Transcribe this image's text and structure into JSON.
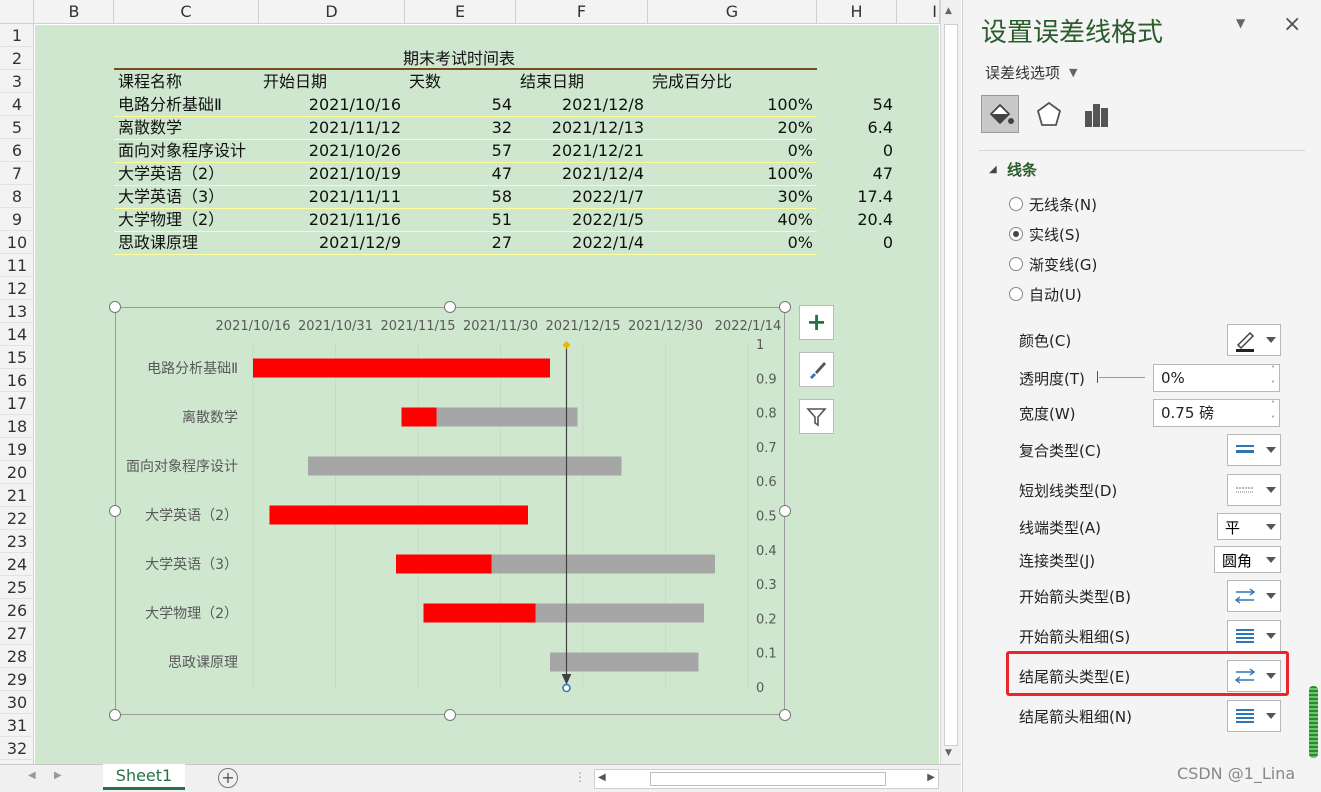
{
  "columns": [
    "B",
    "C",
    "D",
    "E",
    "F",
    "G",
    "H",
    "I"
  ],
  "rows": [
    "1",
    "2",
    "3",
    "4",
    "5",
    "6",
    "7",
    "8",
    "9",
    "10",
    "11",
    "12",
    "13",
    "14",
    "15",
    "16",
    "17",
    "18",
    "19",
    "20",
    "21",
    "22",
    "23",
    "24",
    "25",
    "26",
    "27",
    "28",
    "29",
    "30",
    "31",
    "32"
  ],
  "table": {
    "title": "期末考试时间表",
    "headers": [
      "课程名称",
      "开始日期",
      "天数",
      "结束日期",
      "完成百分比"
    ],
    "rows": [
      {
        "course": "电路分析基础Ⅱ",
        "start": "2021/10/16",
        "days": "54",
        "end": "2021/12/8",
        "pct": "100%",
        "h": "54"
      },
      {
        "course": "离散数学",
        "start": "2021/11/12",
        "days": "32",
        "end": "2021/12/13",
        "pct": "20%",
        "h": "6.4"
      },
      {
        "course": "面向对象程序设计",
        "start": "2021/10/26",
        "days": "57",
        "end": "2021/12/21",
        "pct": "0%",
        "h": "0"
      },
      {
        "course": "大学英语（2）",
        "start": "2021/10/19",
        "days": "47",
        "end": "2021/12/4",
        "pct": "100%",
        "h": "47"
      },
      {
        "course": "大学英语（3）",
        "start": "2021/11/11",
        "days": "58",
        "end": "2022/1/7",
        "pct": "30%",
        "h": "17.4"
      },
      {
        "course": "大学物理（2）",
        "start": "2021/11/16",
        "days": "51",
        "end": "2022/1/5",
        "pct": "40%",
        "h": "20.4"
      },
      {
        "course": "思政课原理",
        "start": "2021/12/9",
        "days": "27",
        "end": "2022/1/4",
        "pct": "0%",
        "h": "0"
      }
    ]
  },
  "chart_data": {
    "type": "bar",
    "orientation": "horizontal-stacked-gantt",
    "categories": [
      "电路分析基础Ⅱ",
      "离散数学",
      "面向对象程序设计",
      "大学英语（2）",
      "大学英语（3）",
      "大学物理（2）",
      "思政课原理"
    ],
    "x_tick_labels": [
      "2021/10/16",
      "2021/10/31",
      "2021/11/15",
      "2021/11/30",
      "2021/12/15",
      "2021/12/30",
      "2022/1/14"
    ],
    "x_range": [
      "2021/10/16",
      "2022/1/14"
    ],
    "start": [
      "2021/10/16",
      "2021/11/12",
      "2021/10/26",
      "2021/10/19",
      "2021/11/11",
      "2021/11/16",
      "2021/12/9"
    ],
    "series": [
      {
        "values": [
          54,
          6.4,
          0,
          47,
          17.4,
          20.4,
          0
        ],
        "color": "#ff0000"
      },
      {
        "values": [
          0,
          25.6,
          57,
          0,
          40.6,
          30.6,
          27
        ],
        "color": "#a6a6a6"
      }
    ],
    "secondary_axis": {
      "ticks": [
        "1",
        "0.9",
        "0.8",
        "0.7",
        "0.6",
        "0.5",
        "0.4",
        "0.3",
        "0.2",
        "0.1",
        "0"
      ]
    },
    "error_line": {
      "date": "2021/12/12",
      "arrow": "end"
    }
  },
  "chart_buttons": [
    "plus-icon",
    "brush-icon",
    "filter-icon"
  ],
  "sheet_tab": "Sheet1",
  "panel": {
    "title": "设置误差线格式",
    "options_label": "误差线选项",
    "section": "线条",
    "radios": [
      {
        "label": "无线条(N)",
        "checked": false
      },
      {
        "label": "实线(S)",
        "checked": true
      },
      {
        "label": "渐变线(G)",
        "checked": false
      },
      {
        "label": "自动(U)",
        "checked": false
      }
    ],
    "color_label": "颜色(C)",
    "transparency_label": "透明度(T)",
    "transparency_value": "0%",
    "width_label": "宽度(W)",
    "width_value": "0.75 磅",
    "compound_label": "复合类型(C)",
    "dash_label": "短划线类型(D)",
    "cap_label": "线端类型(A)",
    "cap_value": "平",
    "join_label": "连接类型(J)",
    "join_value": "圆角",
    "begin_arrow_type_label": "开始箭头类型(B)",
    "begin_arrow_size_label": "开始箭头粗细(S)",
    "end_arrow_type_label": "结尾箭头类型(E)",
    "end_arrow_size_label": "结尾箭头粗细(N)"
  },
  "watermark": "CSDN @1_Lina"
}
